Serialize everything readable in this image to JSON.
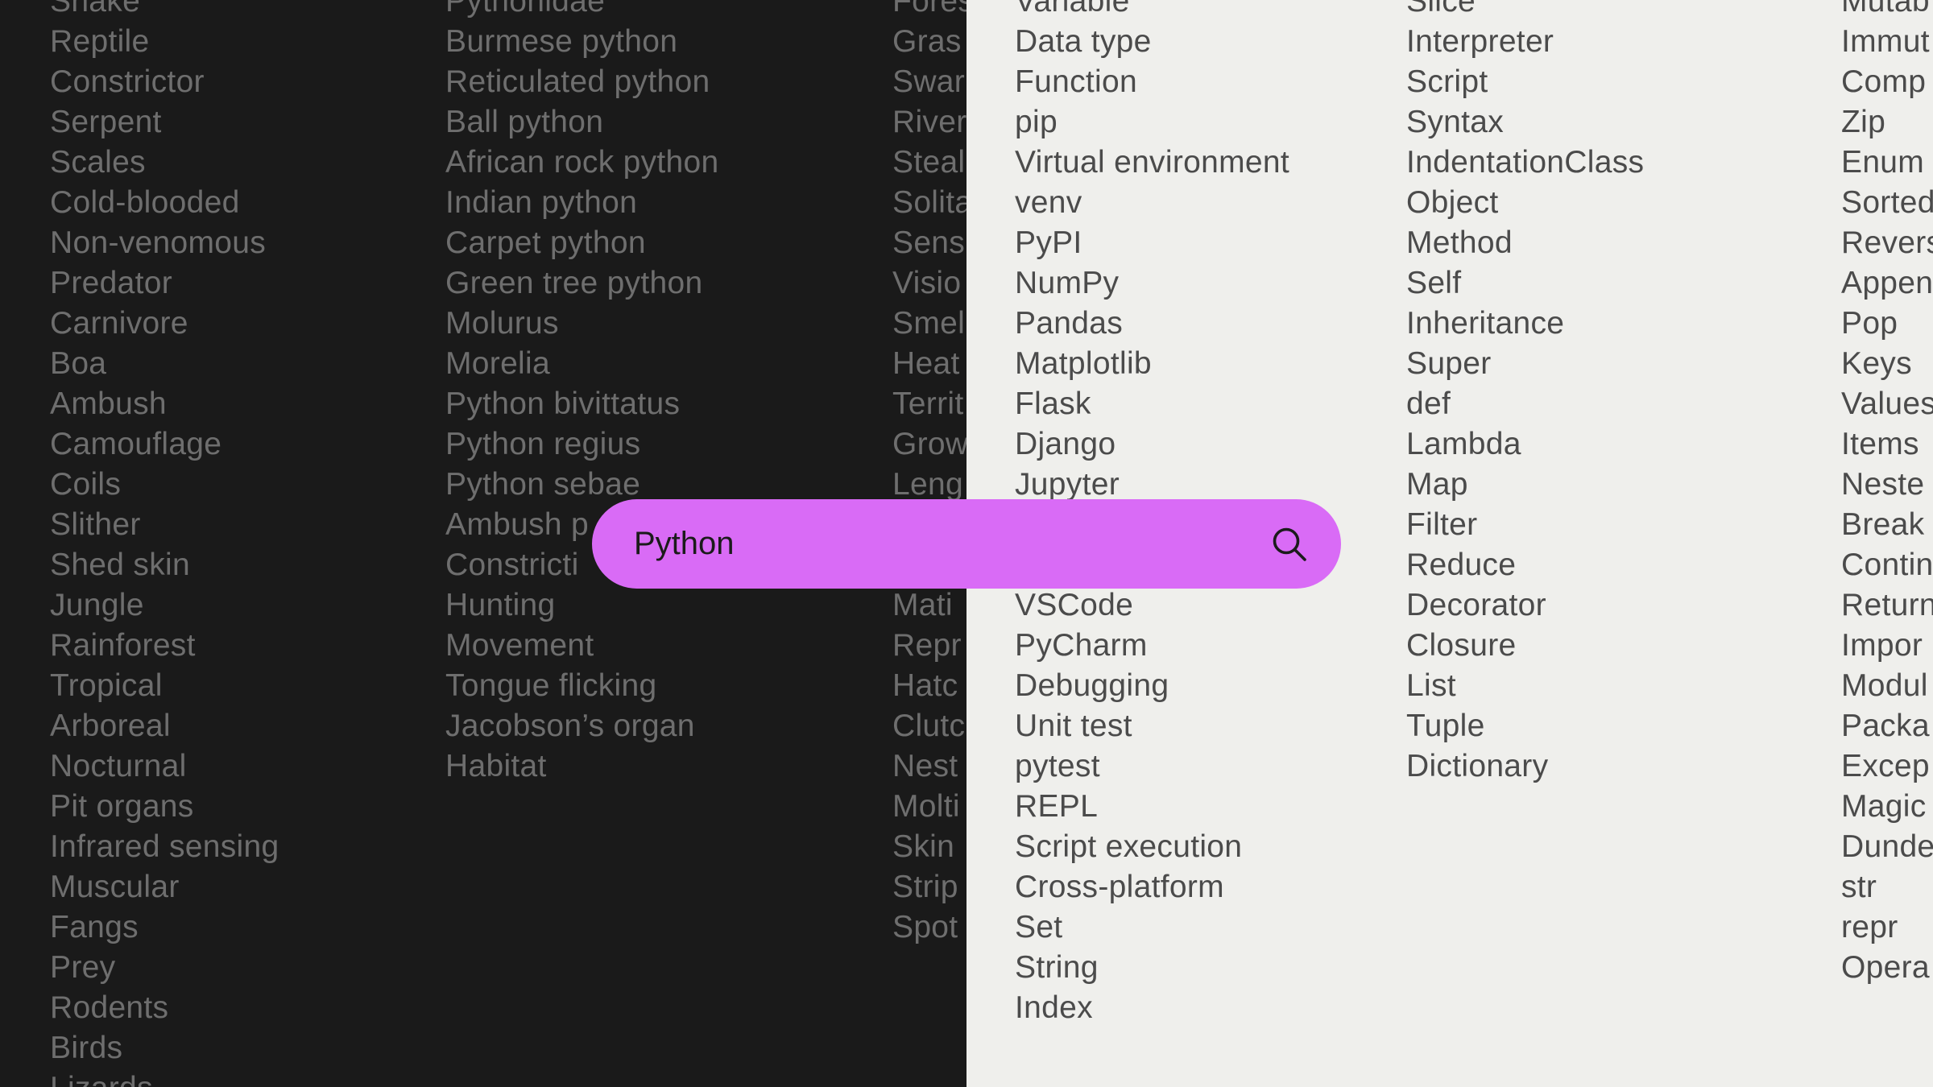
{
  "search": {
    "value": "Python",
    "icon": "search-icon",
    "accent_color": "#d96bf6"
  },
  "snake_terms": [
    "Snake",
    "Reptile",
    "Constrictor",
    "Serpent",
    "Scales",
    "Cold-blooded",
    "Non-venomous",
    "Predator",
    "Carnivore",
    "Boa",
    "Ambush",
    "Camouflage",
    "Coils",
    "Slither",
    "Shed skin",
    "Jungle",
    "Rainforest",
    "Tropical",
    "Arboreal",
    "Nocturnal",
    "Pit organs",
    "Infrared sensing",
    "Muscular",
    "Fangs",
    "Prey",
    "Rodents",
    "Birds",
    "Lizards"
  ],
  "python_species": [
    "Pythonidae",
    "Burmese python",
    "Reticulated python",
    "Ball python",
    "African rock python",
    "Indian python",
    "Carpet python",
    "Green tree python",
    "Molurus",
    "Morelia",
    "Python bivittatus",
    "Python regius",
    "Python sebae",
    "Ambush p",
    "Constricti",
    "Hunting",
    "Movement",
    "Tongue flicking",
    "Jacobson’s organ",
    "Habitat"
  ],
  "habitat_terms": [
    "Fores",
    "Gras",
    "Swar",
    "River",
    "Steal",
    "Solita",
    "Sens",
    "Visio",
    "Smel",
    "Heat",
    "Territ",
    "Grow",
    "Leng",
    "",
    "",
    "Mati",
    "Repr",
    "Hatc",
    "Clutc",
    "Nest",
    "Molti",
    "Skin",
    "Strip",
    "Spot"
  ],
  "programming_terms": [
    "Variable",
    "Data type",
    "Function",
    "pip",
    "Virtual environment",
    "venv",
    "PyPI",
    "NumPy",
    "Pandas",
    "Matplotlib",
    "Flask",
    "Django",
    "Jupyter",
    "",
    "",
    "VSCode",
    "PyCharm",
    "Debugging",
    "Unit test",
    "pytest",
    "REPL",
    "Script execution",
    "Cross-platform",
    "Set",
    "String",
    "Index"
  ],
  "language_concepts": [
    "Slice",
    "Interpreter",
    "Script",
    "Syntax",
    "IndentationClass",
    "Object",
    "Method",
    "Self",
    "Inheritance",
    "Super",
    "def",
    "Lambda",
    "Map",
    "Filter",
    "Reduce",
    "Decorator",
    "Closure",
    "List",
    "Tuple",
    "Dictionary"
  ],
  "builtin_terms": [
    "Mutab",
    "Immut",
    "Comp",
    "Zip",
    "Enum",
    "Sorted",
    "Revers",
    "Appen",
    "Pop",
    "Keys",
    "Values",
    "Items",
    "Neste",
    "Break",
    "Contin",
    "Return",
    "Impor",
    "Modul",
    "Packa",
    "Excep",
    "Magic",
    "Dunde",
    "str",
    "repr",
    "Opera"
  ]
}
